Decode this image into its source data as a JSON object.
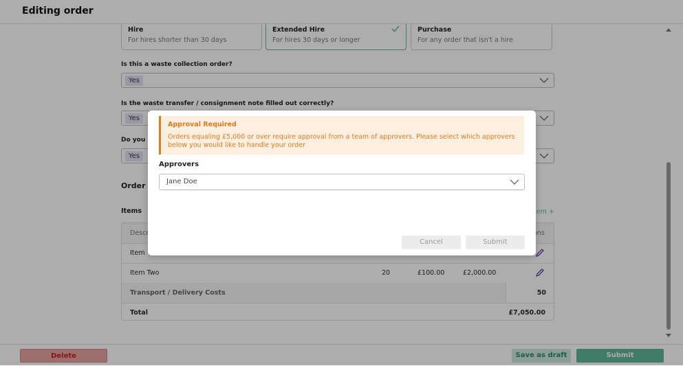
{
  "header": {
    "title": "Editing order"
  },
  "order_types": [
    {
      "title": "Hire",
      "desc": "For hires shorter than 30 days",
      "selected": false
    },
    {
      "title": "Extended Hire",
      "desc": "For hires 30 days or longer",
      "selected": true
    },
    {
      "title": "Purchase",
      "desc": "For any order that isn't a hire",
      "selected": false
    }
  ],
  "questions": [
    {
      "label": "Is this a waste collection order?",
      "value": "Yes"
    },
    {
      "label": "Is the waste transfer / consignment note filled out correctly?",
      "value": "Yes"
    },
    {
      "label": "Do you h",
      "value": "Yes"
    }
  ],
  "order_section": {
    "heading": "Order I",
    "items_label": "Items",
    "add_item": "tem +"
  },
  "table": {
    "header": {
      "desc": "Descr",
      "actions": "ons"
    },
    "rows": [
      {
        "name": "Item",
        "qty": "",
        "price": "",
        "total": ""
      },
      {
        "name": "Item Two",
        "qty": "20",
        "price": "£100.00",
        "total": "£2,000.00"
      }
    ],
    "transport": {
      "label": "Transport / Delivery Costs",
      "value": "50"
    },
    "total": {
      "label": "Total",
      "value": "£7,050.00"
    }
  },
  "modal": {
    "alert_title": "Approval Required",
    "alert_body": "Orders equaling £5,000 or over require approval from a team of approvers. Please select which approvers below you would like to handle your order",
    "approvers_label": "Approvers",
    "approvers_value": "Jane Doe",
    "cancel": "Cancel",
    "submit": "Submit"
  },
  "footer": {
    "delete": "Delete",
    "save_draft": "Save as draft",
    "submit": "Submit"
  },
  "colors": {
    "accent": "#5fb59a",
    "warning": "#e07a1f",
    "danger": "#e8a3a3",
    "pill": "#e5e0f5"
  }
}
